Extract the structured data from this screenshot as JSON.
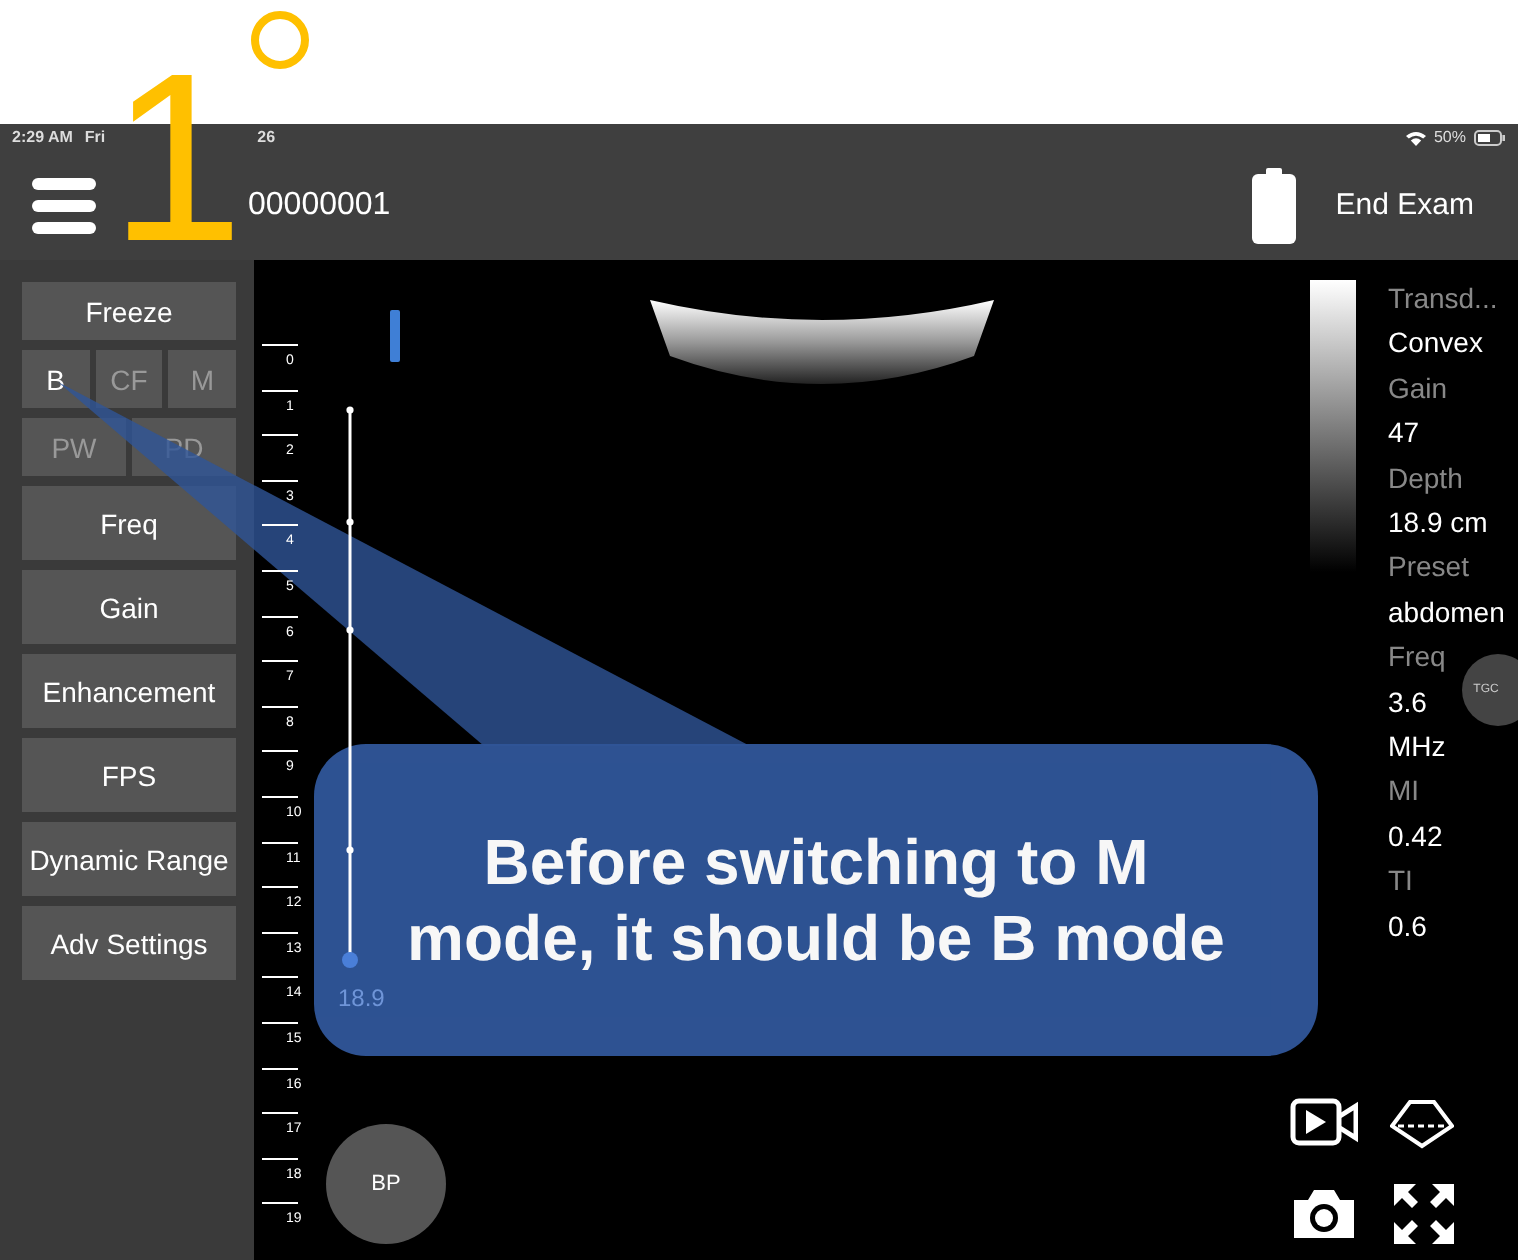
{
  "step_marker": {
    "number": "1"
  },
  "status_bar": {
    "time": "2:29 AM",
    "date_parts": [
      "Fri",
      "26"
    ],
    "battery": "50%"
  },
  "header": {
    "exam_id": "00000001",
    "end_exam": "End Exam"
  },
  "sidebar": [
    {
      "kind": "button",
      "label": "Freeze"
    },
    {
      "kind": "modes",
      "modes": [
        {
          "label": "B",
          "selected": true
        },
        {
          "label": "CF",
          "selected": false
        },
        {
          "label": "M",
          "selected": false
        }
      ]
    },
    {
      "kind": "modes",
      "modes": [
        {
          "label": "PW",
          "selected": false
        },
        {
          "label": "PD",
          "selected": false
        }
      ]
    },
    {
      "kind": "button",
      "label": "Freq"
    },
    {
      "kind": "button",
      "label": "Gain"
    },
    {
      "kind": "button",
      "label": "Enhancement"
    },
    {
      "kind": "button",
      "label": "FPS"
    },
    {
      "kind": "button",
      "label": "Dynamic Range"
    },
    {
      "kind": "button",
      "label": "Adv Settings"
    }
  ],
  "ruler": [
    "0",
    "1",
    "2",
    "3",
    "4",
    "5",
    "6",
    "7",
    "8",
    "9",
    "10",
    "11",
    "12",
    "13",
    "14",
    "15",
    "16",
    "17",
    "18",
    "19"
  ],
  "depth_slider": {
    "reading": "18.9"
  },
  "info": [
    {
      "label": "Transd...",
      "values": [
        "Convex"
      ]
    },
    {
      "label": "Gain",
      "values": [
        "47"
      ]
    },
    {
      "label": "Depth",
      "values": [
        "18.9 cm"
      ]
    },
    {
      "label": "Preset",
      "values": [
        "abdomen"
      ]
    },
    {
      "label": "Freq",
      "values": [
        "3.6",
        "MHz"
      ]
    },
    {
      "label": "MI",
      "values": [
        "0.42"
      ]
    },
    {
      "label": "TI",
      "values": [
        "0.6"
      ]
    }
  ],
  "tgc": "TGC",
  "bp": "BP",
  "callout": {
    "text": "Before switching to M mode, it should be B mode"
  }
}
